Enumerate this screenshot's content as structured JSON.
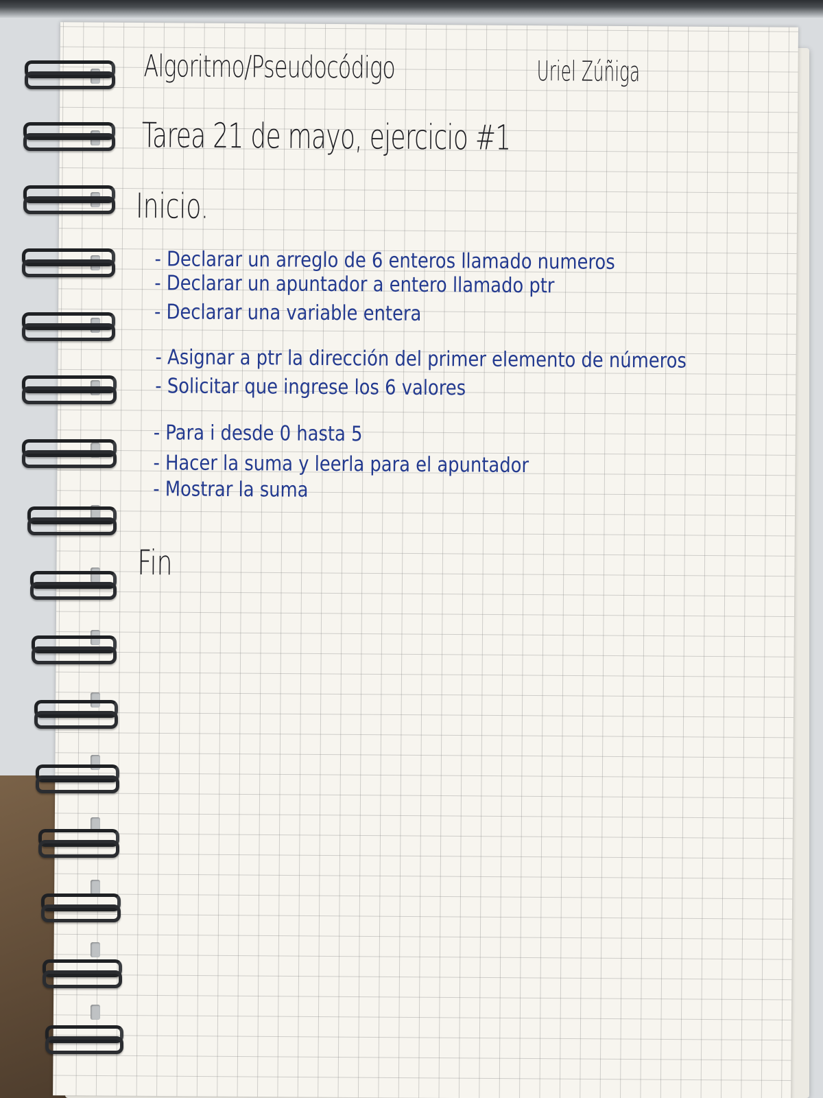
{
  "notebook": {
    "title": "Algoritmo/Pseudocódigo",
    "author": "Uriel Zúñiga",
    "subtitle": "Tarea 21 de mayo, ejercicio #1",
    "start_label": "Inicio.",
    "end_label": "Fin",
    "steps": [
      "- Declarar un arreglo de 6 enteros llamado numeros",
      "- Declarar un apuntador a entero llamado ptr",
      "- Declarar una variable entera",
      "- Asignar a ptr la dirección del primer elemento de números",
      "- Solicitar que ingrese los 6 valores",
      "- Para i desde 0 hasta 5",
      "- Hacer la suma y leerla para el apuntador",
      "- Mostrar la suma"
    ]
  },
  "colors": {
    "ink_black": "#1d1d22",
    "ink_blue": "#233a8f",
    "paper": "#f7f5ef",
    "spiral": "#1f2124"
  },
  "icons": {
    "binding": "spiral-binding-icon"
  }
}
